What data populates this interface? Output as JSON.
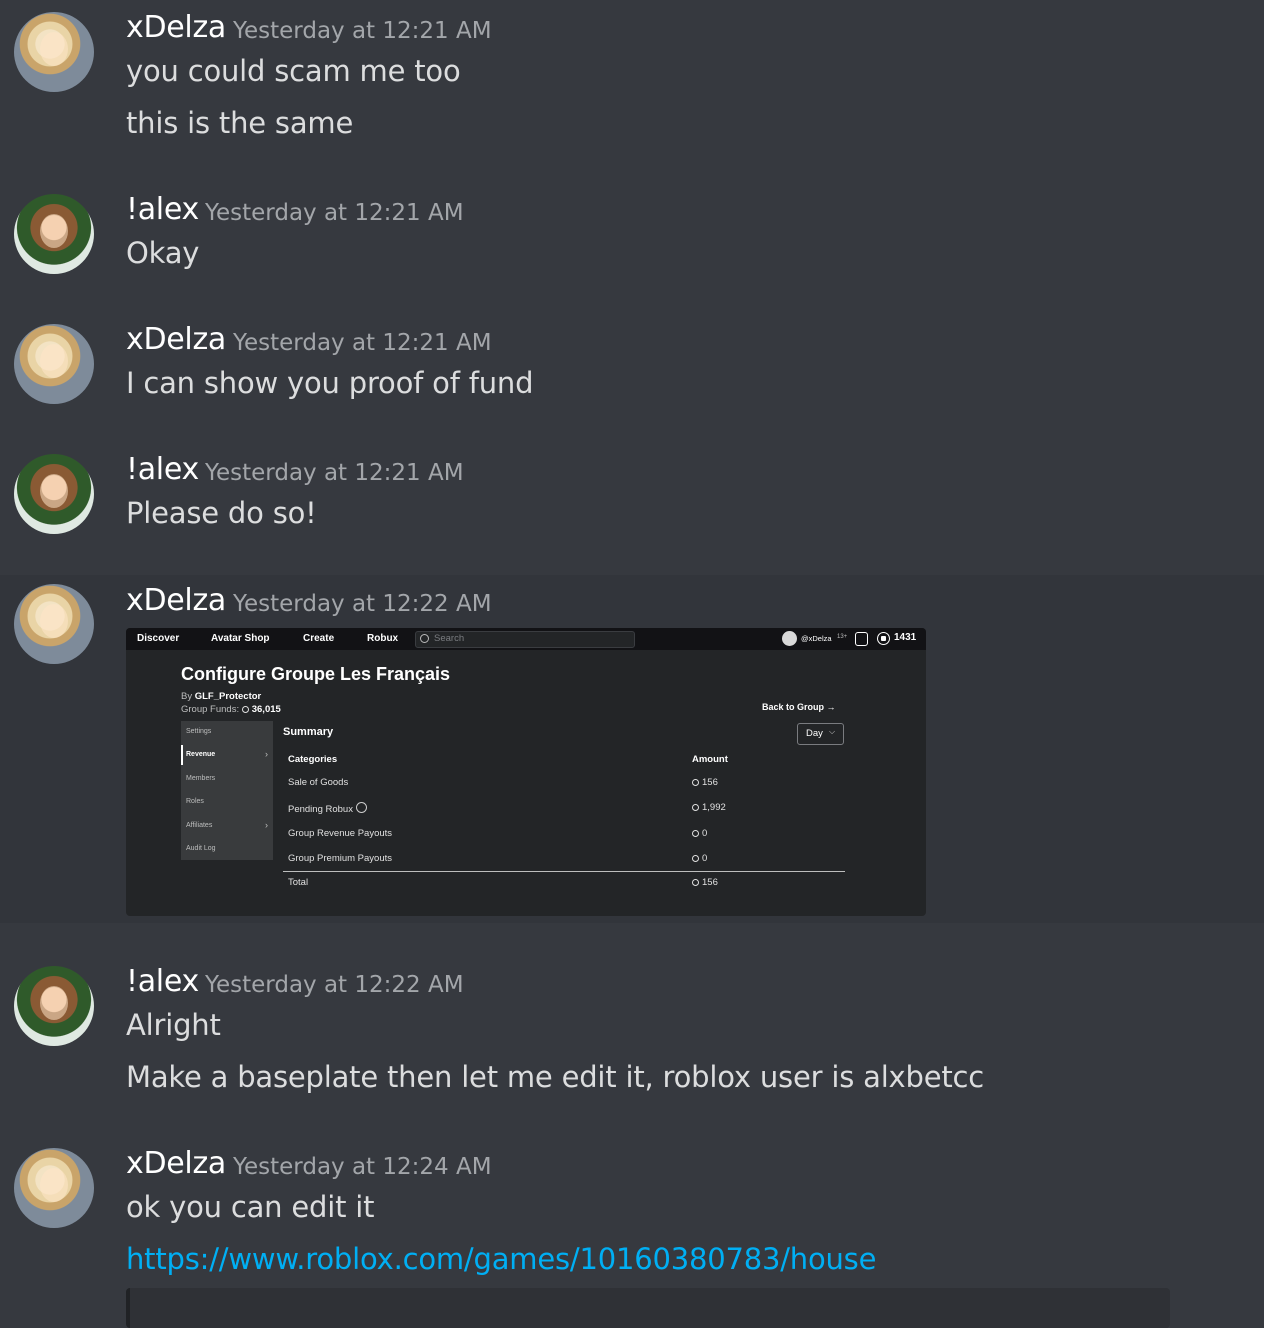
{
  "messages": [
    {
      "author": "xDelza",
      "timestamp": "Yesterday at 12:21 AM",
      "lines": [
        "you could scam me too",
        "this is the same"
      ]
    },
    {
      "author": "!alex",
      "timestamp": "Yesterday at 12:21 AM",
      "lines": [
        "Okay"
      ]
    },
    {
      "author": "xDelza",
      "timestamp": "Yesterday at 12:21 AM",
      "lines": [
        "I can show you proof of fund"
      ]
    },
    {
      "author": "!alex",
      "timestamp": "Yesterday at 12:21 AM",
      "lines": [
        "Please do so!"
      ]
    },
    {
      "author": "xDelza",
      "timestamp": "Yesterday at 12:22 AM",
      "lines": []
    },
    {
      "author": "!alex",
      "timestamp": "Yesterday at 12:22 AM",
      "lines": [
        "Alright",
        "Make a baseplate then let me edit it, roblox user is alxbetcc"
      ]
    },
    {
      "author": "xDelza",
      "timestamp": "Yesterday at 12:24 AM",
      "lines": [
        "ok you can edit it"
      ],
      "link": "https://www.roblox.com/games/10160380783/house"
    }
  ],
  "screenshot": {
    "nav": [
      "Discover",
      "Avatar Shop",
      "Create",
      "Robux"
    ],
    "search_placeholder": "Search",
    "user": "@xDelza",
    "age_badge": "13+",
    "robux": "1431",
    "title": "Configure Groupe Les Français",
    "by_label": "By",
    "owner": "GLF_Protector",
    "funds_label": "Group Funds:",
    "funds": "36,015",
    "back_link": "Back to Group →",
    "period": "Day",
    "sidebar": [
      "Settings",
      "Revenue",
      "Members",
      "Roles",
      "Affiliates",
      "Audit Log"
    ],
    "summary_title": "Summary",
    "col_categories": "Categories",
    "col_amount": "Amount",
    "rows": [
      {
        "category": "Sale of Goods",
        "amount": "156"
      },
      {
        "category": "Pending Robux",
        "amount": "1,992"
      },
      {
        "category": "Group Revenue Payouts",
        "amount": "0"
      },
      {
        "category": "Group Premium Payouts",
        "amount": "0"
      }
    ],
    "total_label": "Total",
    "total_amount": "156"
  }
}
